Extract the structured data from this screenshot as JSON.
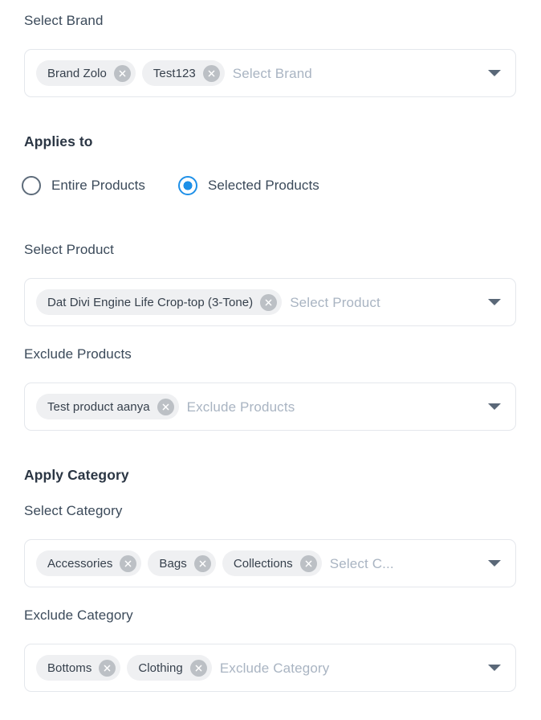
{
  "brand": {
    "label": "Select Brand",
    "placeholder": "Select Brand",
    "chips": [
      {
        "label": "Brand Zolo"
      },
      {
        "label": "Test123"
      }
    ]
  },
  "applies_to": {
    "heading": "Applies to",
    "options": [
      {
        "label": "Entire Products",
        "selected": false
      },
      {
        "label": "Selected Products",
        "selected": true
      }
    ]
  },
  "select_product": {
    "label": "Select Product",
    "placeholder": "Select Product",
    "chips": [
      {
        "label": "Dat Divi Engine Life Crop-top (3-Tone)"
      }
    ]
  },
  "exclude_products": {
    "label": "Exclude Products",
    "placeholder": "Exclude Products",
    "chips": [
      {
        "label": "Test product aanya"
      }
    ]
  },
  "apply_category": {
    "heading": "Apply Category"
  },
  "select_category": {
    "label": "Select Category",
    "placeholder": "Select C...",
    "chips": [
      {
        "label": "Accessories"
      },
      {
        "label": "Bags"
      },
      {
        "label": "Collections"
      }
    ]
  },
  "exclude_category": {
    "label": "Exclude Category",
    "placeholder": "Exclude Category",
    "chips": [
      {
        "label": "Bottoms"
      },
      {
        "label": "Clothing"
      }
    ]
  },
  "colors": {
    "accent": "#1e90e8",
    "chip_bg": "#eff0f2",
    "chip_remove_bg": "#bcc0c5",
    "field_border": "#e4e7ec",
    "label_text": "#3b4a5a",
    "placeholder_text": "#a9b4c2",
    "arrow": "#5a6878"
  },
  "icons": {
    "chip_remove": "close-icon",
    "dropdown": "chevron-down-icon"
  }
}
